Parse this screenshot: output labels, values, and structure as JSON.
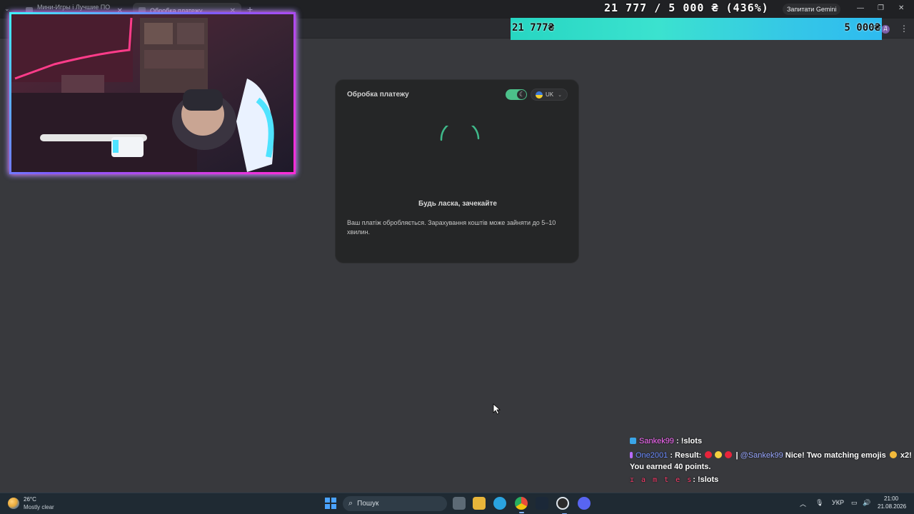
{
  "browser": {
    "tabs": [
      {
        "label": "Мини-Игры і Лучшие ПО ва..."
      },
      {
        "label": "Обробка платежу"
      }
    ],
    "tab_list_icon": "chevron-down-icon",
    "new_tab_icon": "plus-icon",
    "gemini_button": "Запитати Gemini",
    "profile_initial": "Д"
  },
  "overlay": {
    "goal_text": "21 777 / 5 000 ₴ (436%)",
    "goal_progress_percent": 436,
    "goal_current": "21 777₴",
    "goal_target": "5 000₴",
    "accent_colors": {
      "bar_start": "#27d6c2",
      "bar_end": "#2ebbf0",
      "cam_border_start": "#3ff0ff",
      "cam_border_end": "#ff2bd6"
    }
  },
  "payment": {
    "title": "Обробка платежу",
    "theme_toggle_on": true,
    "language": "UK",
    "wait_title": "Будь ласка, зачекайте",
    "wait_description": "Ваш платіж обробляється. Зарахування коштів може зайняти до 5–10 хвилин.",
    "accent_color": "#4cc08a"
  },
  "chat": {
    "messages": [
      {
        "user": "Sankek99",
        "text": ": !slots"
      },
      {
        "user": "One2001",
        "text_before": ": Result:",
        "mention": "@Sankek99",
        "text_after": "Nice! Two matching emojis",
        "multiplier": "x2!"
      },
      {
        "text": "You earned 40 points."
      },
      {
        "user": "ɪ a m t e s",
        "text": ": !slots"
      }
    ]
  },
  "taskbar": {
    "weather_temp": "26°C",
    "weather_desc": "Mostly clear",
    "search_placeholder": "Пошук",
    "language": "УКР",
    "time": "21:00",
    "date": "21.08.2026"
  }
}
